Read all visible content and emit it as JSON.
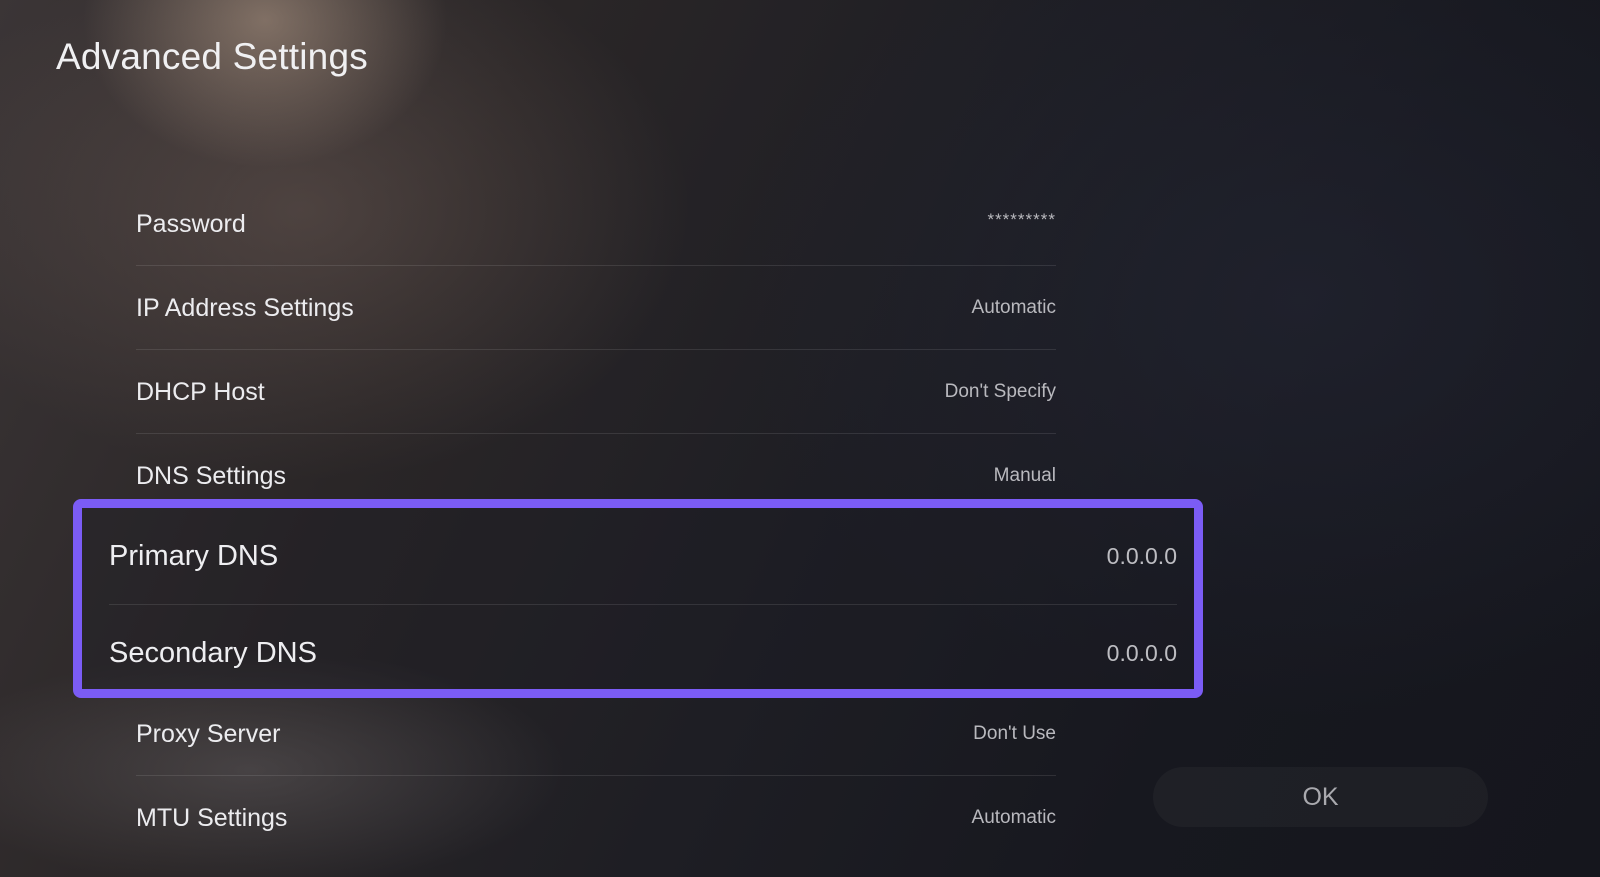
{
  "page": {
    "title": "Advanced Settings"
  },
  "settings": [
    {
      "label": "Password",
      "value": "*********"
    },
    {
      "label": "IP Address Settings",
      "value": "Automatic"
    },
    {
      "label": "DHCP Host",
      "value": "Don't Specify"
    },
    {
      "label": "DNS Settings",
      "value": "Manual"
    },
    {
      "label": "Primary DNS",
      "value": "0.0.0.0"
    },
    {
      "label": "Secondary DNS",
      "value": "0.0.0.0"
    },
    {
      "label": "Proxy Server",
      "value": "Don't Use"
    },
    {
      "label": "MTU Settings",
      "value": "Automatic"
    }
  ],
  "actions": {
    "ok_label": "OK"
  },
  "colors": {
    "highlight": "#7b5cf5",
    "background": "#15161c"
  }
}
